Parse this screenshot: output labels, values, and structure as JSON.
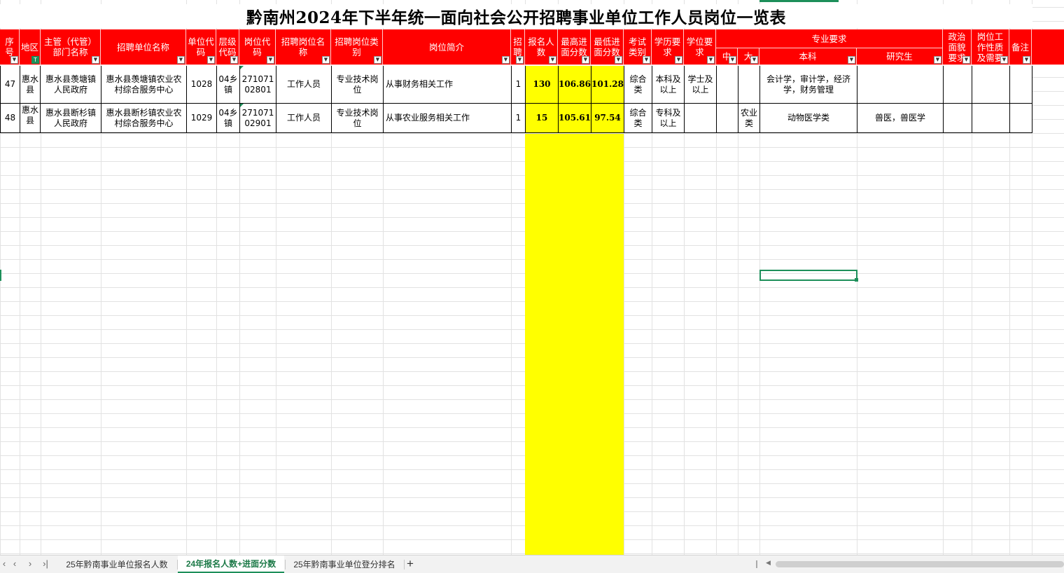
{
  "sheet": {
    "title": "黔南州2024年下半年统一面向社会公开招聘事业单位工作人员岗位一览表",
    "headers": {
      "seq": "序号",
      "region": "地区",
      "dept": "主管（代管）部门名称",
      "unit_name": "招聘单位名称",
      "unit_code": "单位代码",
      "level_code": "层级代码",
      "post_code": "岗位代码",
      "post_name": "招聘岗位名称",
      "post_type": "招聘岗位类别",
      "post_intro": "岗位简介",
      "recruit_num": "招聘",
      "applicants": "报名人数",
      "max_score": "最高进面分数",
      "min_score": "最低进面分数",
      "exam_type": "考试类别",
      "education": "学历要求",
      "degree": "学位要求",
      "major_req": "专业要求",
      "major_mid": "中",
      "major_big": "大",
      "major_bachelor": "本科",
      "major_grad": "研究生",
      "political": "政治面貌要求",
      "post_nature": "岗位工作性质及需要",
      "remark": "备注"
    },
    "rows": [
      {
        "seq": "47",
        "region": "惠水县",
        "dept": "惠水县羡塘镇人民政府",
        "unit_name": "惠水县羡塘镇农业农村综合服务中心",
        "unit_code": "1028",
        "level_code": "04乡镇",
        "post_code": "27107102801",
        "post_name": "工作人员",
        "post_type": "专业技术岗位",
        "post_intro": "从事财务相关工作",
        "recruit_num": "1",
        "applicants": "130",
        "max_score": "106.86",
        "min_score": "101.28",
        "exam_type": "综合类",
        "education": "本科及以上",
        "degree": "学士及以上",
        "major_mid": "",
        "major_big": "",
        "major_bachelor": "会计学，审计学，经济学，财务管理",
        "major_grad": "",
        "political": "",
        "post_nature": "",
        "remark": ""
      },
      {
        "seq": "48",
        "region": "惠水县",
        "dept": "惠水县断杉镇人民政府",
        "unit_name": "惠水县断杉镇农业农村综合服务中心",
        "unit_code": "1029",
        "level_code": "04乡镇",
        "post_code": "27107102901",
        "post_name": "工作人员",
        "post_type": "专业技术岗位",
        "post_intro": "从事农业服务相关工作",
        "recruit_num": "1",
        "applicants": "15",
        "max_score": "105.61",
        "min_score": "97.54",
        "exam_type": "综合类",
        "education": "专科及以上",
        "degree": "",
        "major_mid": "",
        "major_big": "农业类",
        "major_bachelor": "动物医学类",
        "major_grad": "兽医，兽医学",
        "political": "",
        "post_nature": "",
        "remark": ""
      }
    ]
  },
  "tabs": [
    {
      "label": "25年黔南事业单位报名人数",
      "active": false
    },
    {
      "label": "24年报名人数+进面分数",
      "active": true
    },
    {
      "label": "25年黔南事业单位登分排名",
      "active": false
    }
  ],
  "tab_nav": {
    "first": "‹",
    "prev": "‹",
    "next": "›",
    "last": "›|",
    "add": "+"
  },
  "colors": {
    "header_red": "#ff0000",
    "highlight_yellow": "#ffff00",
    "accent_green": "#1d8f5a"
  }
}
